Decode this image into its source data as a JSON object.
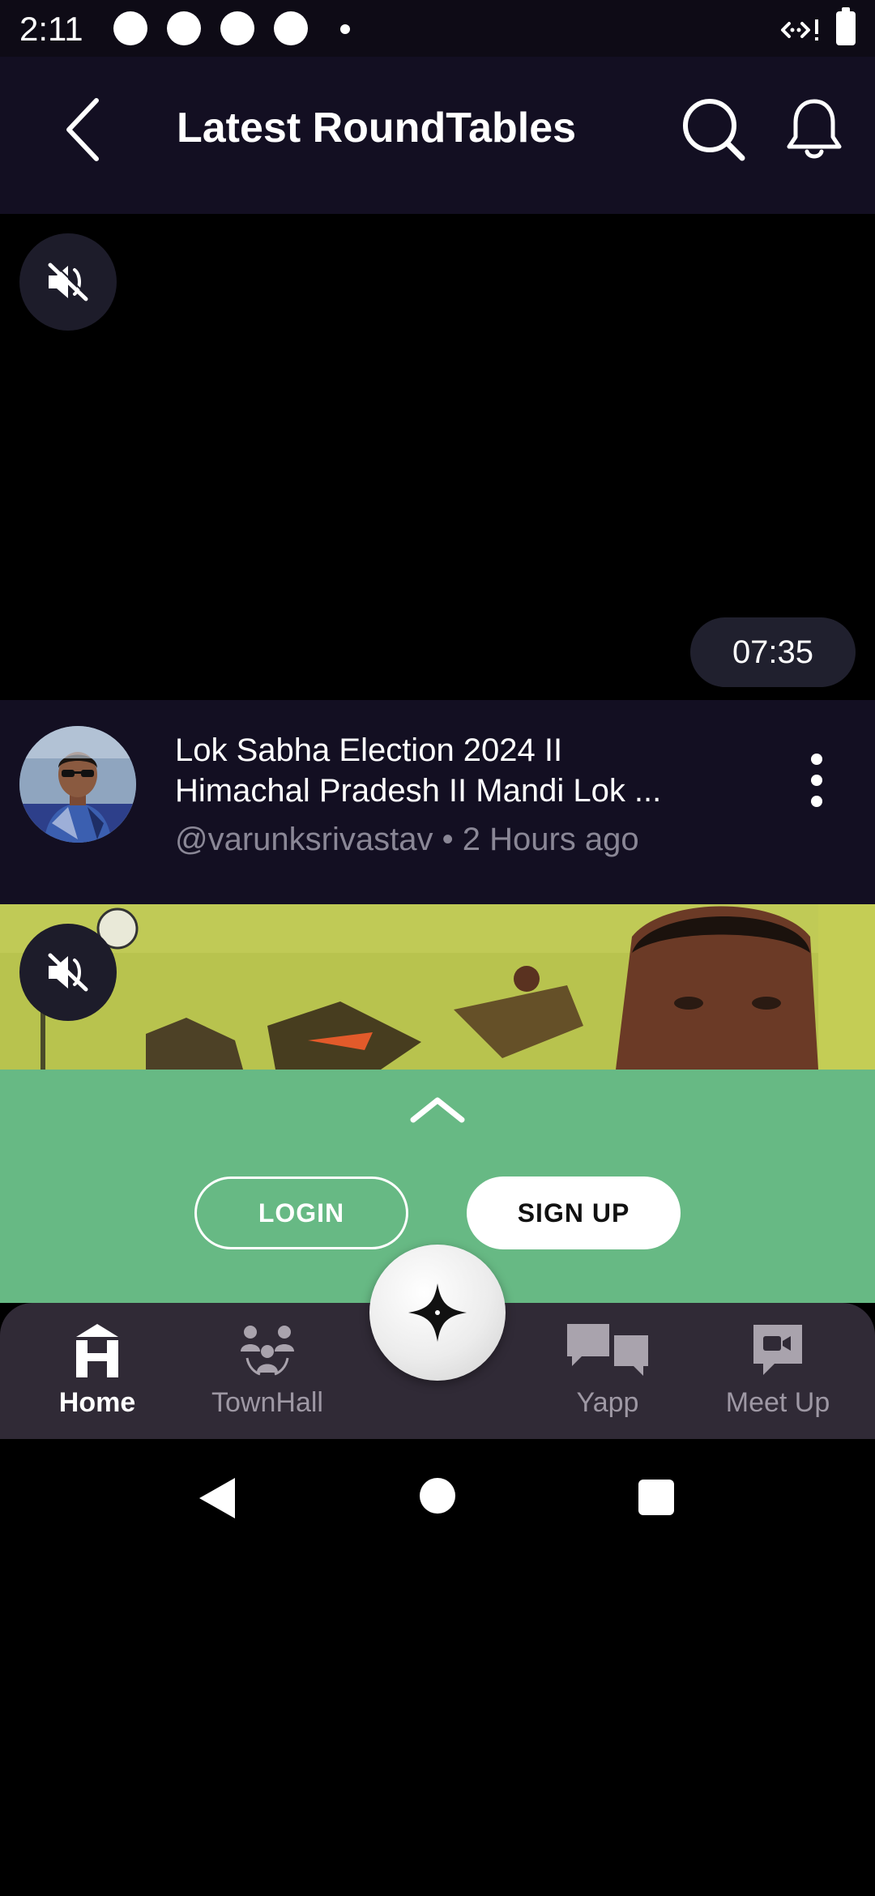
{
  "status_bar": {
    "time": "2:11"
  },
  "header": {
    "title": "Latest RoundTables",
    "back_icon": "back-arrow-icon",
    "search_icon": "search-icon",
    "notification_icon": "bell-icon"
  },
  "videos": [
    {
      "mute_icon": "muted-speaker-icon",
      "duration": "07:35"
    },
    {
      "mute_icon": "muted-speaker-icon"
    }
  ],
  "card": {
    "title_line_1": "Lok Sabha Election 2024 II",
    "title_line_2": "Himachal Pradesh II Mandi Lok ...",
    "meta": "@varunksrivastav • 2 Hours ago"
  },
  "auth_sheet": {
    "expand_icon": "chevron-up-icon",
    "login_label": "LOGIN",
    "signup_label": "SIGN UP"
  },
  "bottom_nav": {
    "items": [
      {
        "label": "Home",
        "icon": "home-icon",
        "active": true
      },
      {
        "label": "TownHall",
        "icon": "townhall-icon",
        "active": false
      },
      {
        "label": "Yapp",
        "icon": "chat-bubbles-icon",
        "active": false
      },
      {
        "label": "Meet Up",
        "icon": "video-camera-icon",
        "active": false
      }
    ],
    "fab_icon": "sparkle-icon"
  },
  "colors": {
    "background": "#000000",
    "header": "#130f22",
    "sheet_green": "#67b984",
    "nav_background": "#302a36",
    "muted_text": "#8a8796"
  }
}
